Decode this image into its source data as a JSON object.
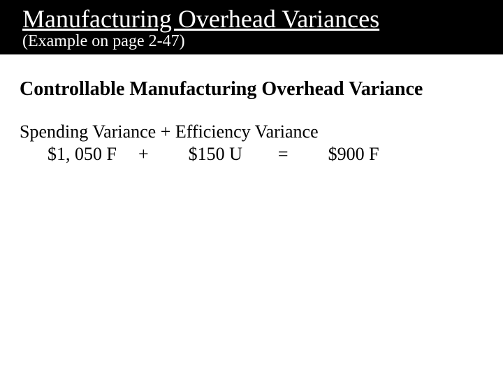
{
  "header": {
    "title": "Manufacturing Overhead Variances",
    "subtitle": "(Example on page 2-47)"
  },
  "content": {
    "section_heading": "Controllable Manufacturing Overhead Variance",
    "formula_label": "Spending Variance + Efficiency Variance",
    "formula": {
      "left_value": "$1, 050 F",
      "op1": "+",
      "mid_value": "$150 U",
      "op2": "=",
      "right_value": "$900 F"
    }
  }
}
